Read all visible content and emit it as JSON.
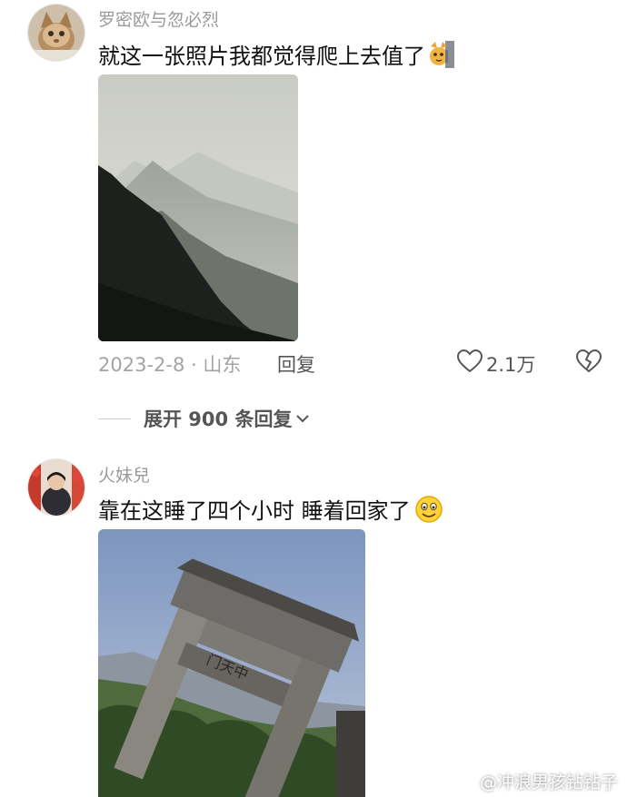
{
  "comments": [
    {
      "username": "罗密欧与忽必烈",
      "text": "就这一张照片我都觉得爬上去值了",
      "meta": "2023-2-8 · 山东",
      "reply_label": "回复",
      "like_count": "2.1万",
      "expand_label": "展开 900 条回复",
      "emoji_icon": "cat-peeking-emoji-icon",
      "photo_subject": "misty mountain ridges"
    },
    {
      "username": "火妹兒",
      "text": "靠在这睡了四个小时 睡着回家了",
      "emoji_icon": "smiling-face-emoji-icon",
      "photo_subject": "stone archway gate",
      "gate_inscription": "门天中"
    }
  ],
  "watermark": "@冲浪男孩钻钻子",
  "colors": {
    "username": "#9a9a9a",
    "meta": "#a3a3a3",
    "action": "#555555"
  }
}
